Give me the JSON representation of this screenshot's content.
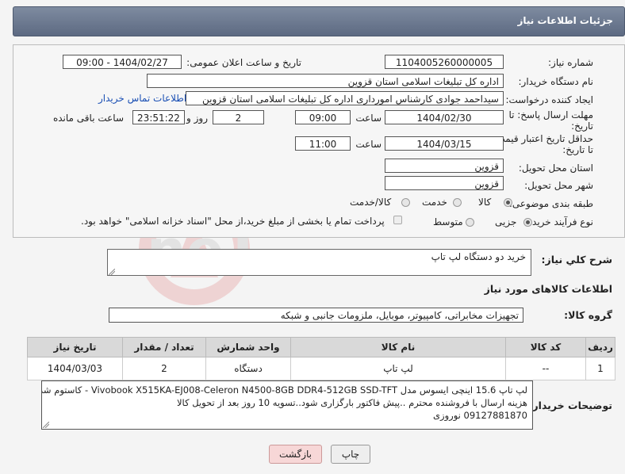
{
  "header": {
    "title": "جزئیات اطلاعات نیاز"
  },
  "form": {
    "need_number_label": "شماره نیاز:",
    "need_number": "1104005260000005",
    "announce_label": "تاریخ و ساعت اعلان عمومی:",
    "announce_value": "1404/02/27 - 09:00",
    "buyer_org_label": "نام دستگاه خریدار:",
    "buyer_org": "اداره کل تبلیغات اسلامی استان قزوین",
    "requester_label": "ایجاد کننده درخواست:",
    "requester": "سیداحمد جوادی کارشناس امورداری اداره کل تبلیغات اسلامی استان قزوین",
    "contact_link": "اطلاعات تماس خریدار",
    "reply_deadline_label_1": "مهلت ارسال پاسخ: تا",
    "reply_deadline_label_2": "تاریخ:",
    "reply_date": "1404/02/30",
    "time_label": "ساعت",
    "reply_time": "09:00",
    "days": "2",
    "days_label": "روز و",
    "remaining": "23:51:22",
    "remaining_label": "ساعت باقی مانده",
    "price_deadline_label_1": "حداقل تاریخ اعتبار قیمت:",
    "price_deadline_label_2": "تا تاریخ:",
    "price_date": "1404/03/15",
    "price_time": "11:00",
    "province_label": "استان محل تحویل:",
    "province": "قزوین",
    "city_label": "شهر محل تحویل:",
    "city": "قزوین",
    "category_label": "طبقه بندی موضوعی:",
    "category_options": [
      "کالا",
      "خدمت",
      "کالا/خدمت"
    ],
    "process_label": "نوع فرآیند خرید :",
    "process_options": [
      "جزیی",
      "متوسط"
    ],
    "payment_note": "پرداخت تمام یا بخشی از مبلغ خرید،از محل \"اسناد خزانه اسلامی\" خواهد بود."
  },
  "description": {
    "label": "شرح کلي نياز:",
    "value": "خرید دو دستگاه لپ تاپ"
  },
  "goods": {
    "section_title": "اطلاعات کالاهای مورد نیاز",
    "group_label": "گروه کالا:",
    "group_value": "تجهیزات مخابراتی، کامپیوتر، موبایل، ملزومات جانبی و شبکه",
    "columns": [
      "ردیف",
      "کد کالا",
      "نام کالا",
      "واحد شمارش",
      "تعداد / مقدار",
      "تاریخ نیاز"
    ],
    "rows": [
      [
        "1",
        "--",
        "لپ تاپ",
        "دستگاه",
        "2",
        "1404/03/03"
      ]
    ]
  },
  "buyer_notes": {
    "label": "توضیحات خریدار:",
    "line1": "لپ تاپ 15.6 اینچی ایسوس مدل Vivobook X515KA-EJ008-Celeron N4500-8GB DDR4-512GB SSD-TFT - کاستوم شده",
    "line2": "هزینه ارسال با فروشنده محترم ..پیش فاکتور بارگزاری شود..تسویه 10 روز بعد از تحویل کالا",
    "line3": "09127881870 نوروزی"
  },
  "buttons": {
    "print": "چاپ",
    "back": "بازگشت"
  },
  "colors": {
    "header": "#6b778d",
    "back_button": "#f7d7d7",
    "link": "#1a4fb4"
  }
}
